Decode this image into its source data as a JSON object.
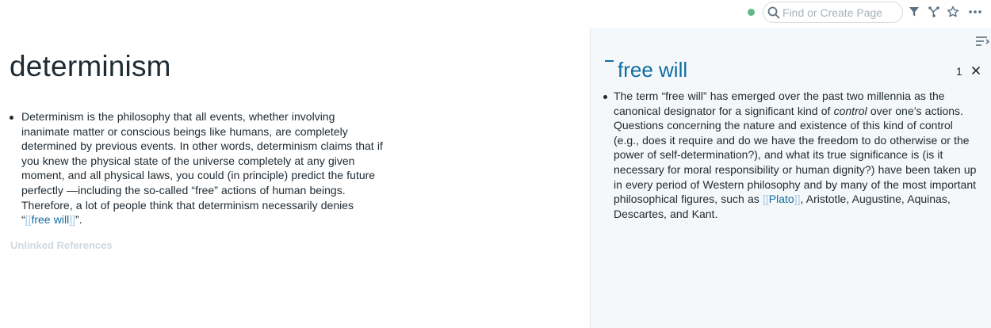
{
  "topbar": {
    "search_placeholder": "Find or Create Page",
    "icons": [
      "sync-status-dot",
      "search-icon",
      "filter-icon",
      "graph-icon",
      "star-icon",
      "more-icon"
    ]
  },
  "main": {
    "title": "determinism",
    "block": {
      "text_before_link": "Determinism is the philosophy that all events, whether involving inanimate matter or conscious beings like humans, are completely determined by previous events. In other words, determinism claims that if you knew the physical state of the universe completely at any given moment, and all physical laws, you could (in principle) predict the future perfectly —including the so-called “free” actions of human beings. Therefore, a lot of people think that determinism necessarily denies “",
      "link_open": "[[",
      "link_text": "free will",
      "link_close": "]]",
      "text_after_link": "”."
    },
    "unlinked_references": "Unlinked References"
  },
  "sidebar": {
    "page_title": "free will",
    "count": "1",
    "block": {
      "part1": "The term “free will” has emerged over the past two millennia as the canonical designator for a significant kind of ",
      "italic": "control",
      "part2": " over one’s actions. Questions concerning the nature and existence of this kind of control (e.g., does it require and do we have the freedom to do otherwise or the power of self-determination?), and what its true significance is (is it necessary for moral responsibility or human dignity?) have been taken up in every period of Western philosophy and by many of the most important philosophical figures, such as ",
      "link_open": "[[",
      "link_text": "Plato",
      "link_close": "]]",
      "part3": ", Aristotle, Augustine, Aquinas, Descartes, and Kant."
    }
  },
  "colors": {
    "link": "#106ba3",
    "link_bracket": "#a7c6e0",
    "sidebar_bg": "#f5f8fa",
    "sync_dot": "#5eb987"
  }
}
